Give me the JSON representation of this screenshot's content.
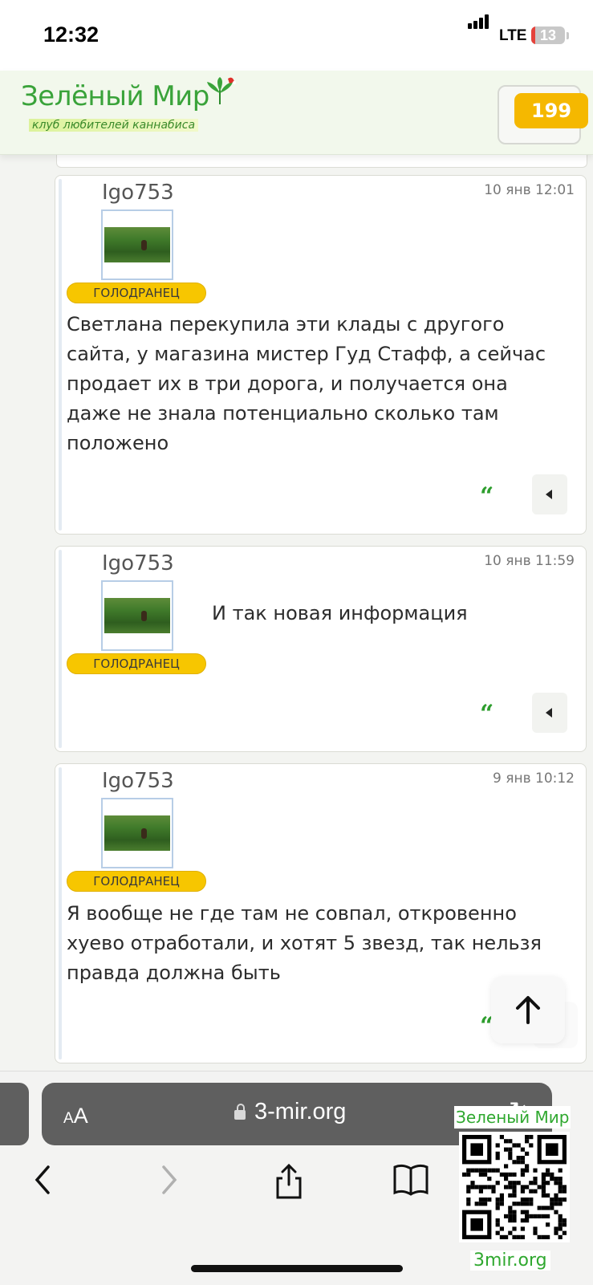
{
  "status_bar": {
    "time": "12:32",
    "network": "LTE",
    "battery_level": 13,
    "battery_text": "13"
  },
  "site": {
    "logo_title": "Зелёный Мир",
    "logo_subtitle": "клуб любителей каннабиса",
    "notification_count": "199",
    "colors": {
      "accent_green": "#3aa33a",
      "badge_yellow": "#f5b800",
      "rank_yellow": "#f7c600"
    }
  },
  "posts": [
    {
      "author": "Igo753",
      "date": "10 янв 12:01",
      "rank": "ГОЛОДРАНЕЦ",
      "lines": [
        "Светлана перекупила эти клады с другого",
        "сайта, у магазина мистер Гуд Стафф, а сейчас",
        "продает их в три дорога, и получается она",
        "даже не знала потенциально сколько там",
        "положено"
      ],
      "quote_icon": "quote-icon",
      "more_icon": "caret-left-icon"
    },
    {
      "author": "Igo753",
      "date": "10 янв 11:59",
      "rank": "ГОЛОДРАНЕЦ",
      "lines": [
        "И так новая информация"
      ],
      "quote_icon": "quote-icon",
      "more_icon": "caret-left-icon"
    },
    {
      "author": "Igo753",
      "date": "9 янв 10:12",
      "rank": "ГОЛОДРАНЕЦ",
      "lines": [
        "Я вообще не где там не совпал, откровенно",
        "хуево отработали, и хотят 5 звезд, так нельзя",
        "правда должна быть"
      ],
      "quote_icon": "quote-icon"
    }
  ],
  "scroll_up_icon": "arrow-up-icon",
  "browser": {
    "aa_label_small": "A",
    "aa_label_large": "A",
    "url": "3-mir.org",
    "toolbar_icons": [
      "back-icon",
      "forward-icon",
      "share-icon",
      "bookmarks-icon"
    ]
  },
  "watermark": {
    "top_text": "Зеленый Мир",
    "bottom_text": "3mir.org"
  }
}
